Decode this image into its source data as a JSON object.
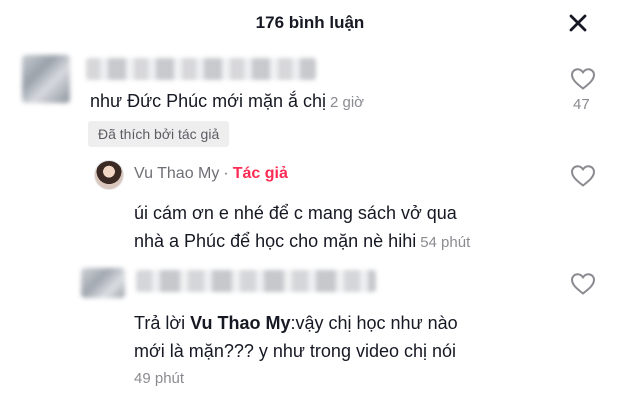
{
  "header": {
    "title": "176 bình luận"
  },
  "comments": [
    {
      "text": "như Đức Phúc mới mặn ắ chị",
      "time": "2 giờ",
      "likes": "47",
      "liked_by_author": "Đã thích bởi tác giả"
    }
  ],
  "replies": [
    {
      "username": "Vu Thao My",
      "separator": "·",
      "author_tag": "Tác giả",
      "line1": "úi cám ơn e nhé để c mang sách vở qua",
      "line2": "nhà a Phúc để học cho mặn nè hihi",
      "time": "54 phút"
    },
    {
      "reply_prefix": "Trả lời",
      "reply_to": "Vu Thao My",
      "line1": ":vậy chị học như nào",
      "line2": "mới là mặn??? y như trong video chị nói",
      "time": "49 phút"
    }
  ],
  "icons": {
    "close": "close-icon",
    "like": "heart-outline-icon"
  },
  "colors": {
    "accent": "#fe2c55",
    "muted": "#8a8b91",
    "text": "#161823"
  }
}
